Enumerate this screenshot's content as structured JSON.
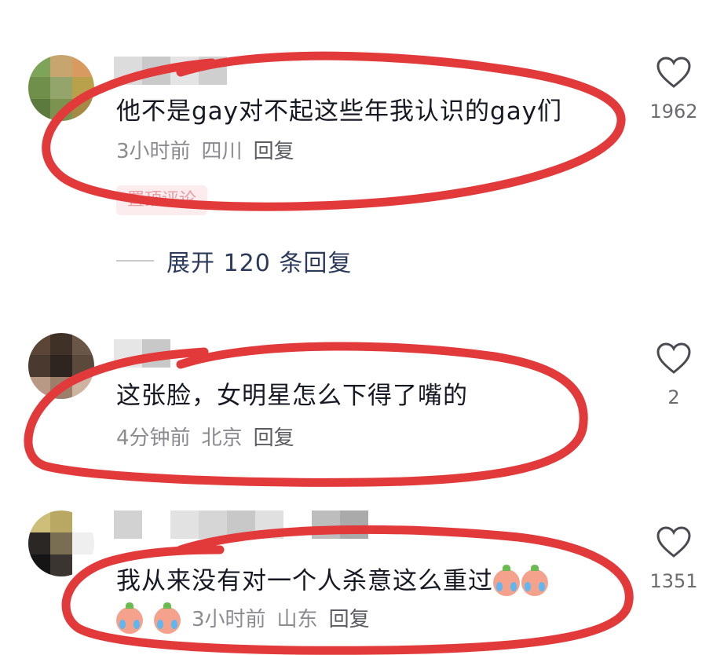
{
  "comments": [
    {
      "text": "他不是gay对不起这些年我认识的gay们",
      "time": "3小时前",
      "location": "四川",
      "reply_label": "回复",
      "likes": "1962",
      "badge": "置顶评论",
      "expand_label": "展开 120 条回复"
    },
    {
      "text": "这张脸，女明星怎么下得了嘴的",
      "time": "4分钟前",
      "location": "北京",
      "reply_label": "回复",
      "likes": "2"
    },
    {
      "text": "我从来没有对一个人杀意这么重过",
      "time": "3小时前",
      "location": "山东",
      "reply_label": "回复",
      "likes": "1351",
      "emoji": "crying-face-emoji"
    }
  ],
  "colors": {
    "circle_annotation": "#e23a3a",
    "text": "#161823",
    "meta": "#8a8b91",
    "expand": "#2b3a5b",
    "badge_bg": "#fdecee"
  }
}
